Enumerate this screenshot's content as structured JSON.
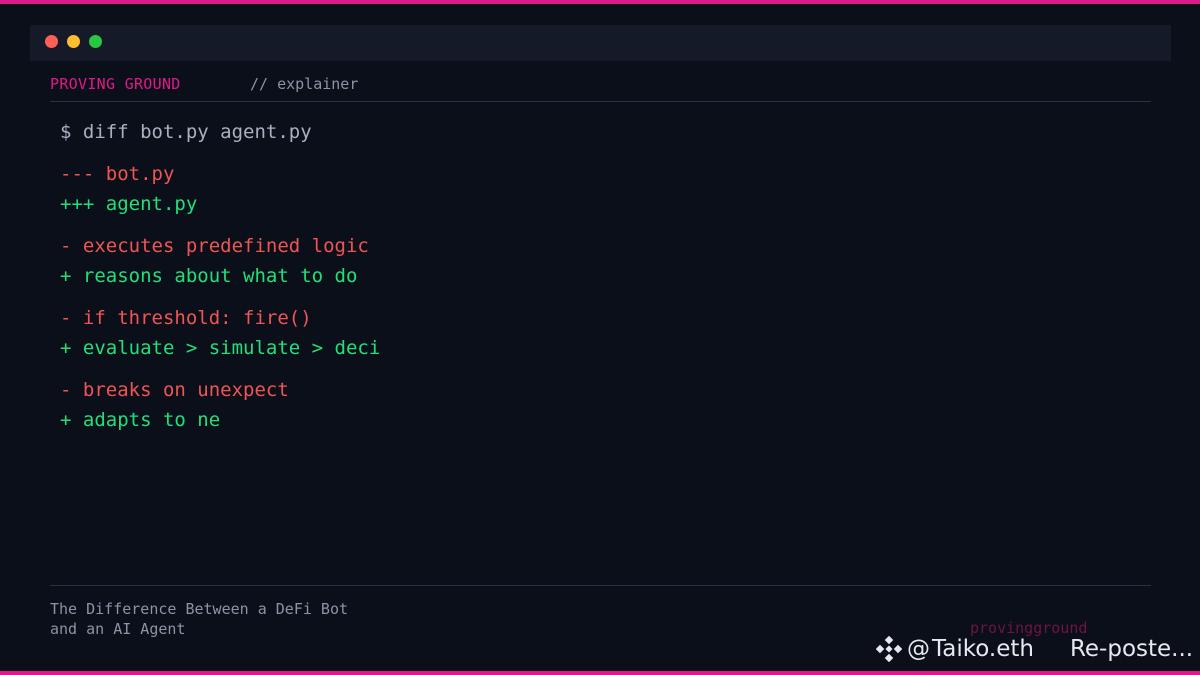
{
  "header": {
    "brand": "PROVING GROUND",
    "section": "// explainer"
  },
  "terminal": {
    "command": "$ diff bot.py agent.py",
    "lines": [
      {
        "kind": "removed",
        "text": "--- bot.py"
      },
      {
        "kind": "added",
        "text": "+++ agent.py"
      },
      {
        "kind": "removed",
        "text": "- executes predefined logic"
      },
      {
        "kind": "added",
        "text": "+ reasons about what to do"
      },
      {
        "kind": "removed",
        "text": "- if threshold: fire()"
      },
      {
        "kind": "added",
        "text": "+ evaluate > simulate > deci"
      },
      {
        "kind": "removed",
        "text": "- breaks on unexpect"
      },
      {
        "kind": "added",
        "text": "+ adapts to ne"
      }
    ]
  },
  "footer": {
    "caption_line1": "The Difference Between a DeFi Bot",
    "caption_line2": "and an AI Agent",
    "handle": "provingground"
  },
  "watermark": {
    "at": "@",
    "name": "Taiko.eth",
    "repost": "Re-poste..."
  },
  "colors": {
    "accent": "#e0198a",
    "removed": "#f05454",
    "added": "#20e07a",
    "background": "#0b0f19"
  },
  "icons": {
    "watermark_logo": "binance-diamond-icon"
  }
}
